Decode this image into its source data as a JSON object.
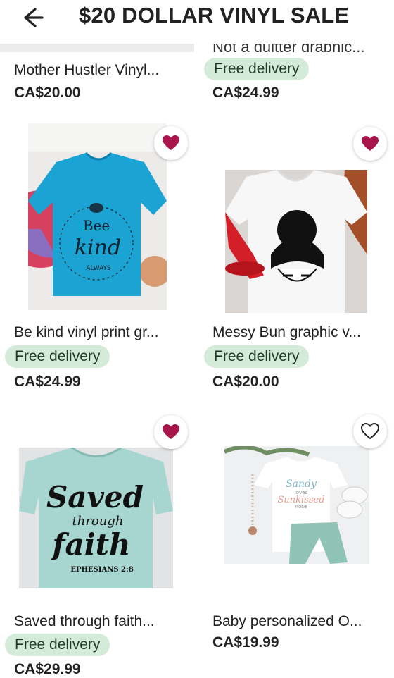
{
  "header": {
    "title": "$20 DOLLAR VINYL SALE",
    "back_icon": "arrow-left-icon"
  },
  "colors": {
    "accent_heart": "#a8154a",
    "badge_bg": "#d5ebd9"
  },
  "top_row": {
    "left": {
      "name": "Mother Hustler Vinyl...",
      "price": "CA$20.00"
    },
    "right": {
      "cut_name": "Not a quitter graphic...",
      "delivery": "Free delivery",
      "price": "CA$24.99"
    }
  },
  "products": [
    {
      "name": "Be kind vinyl print gr...",
      "delivery": "Free delivery",
      "price": "CA$24.99",
      "favorited": true,
      "art": {
        "line1": "Bee",
        "line2": "kind",
        "line3": "ALWAYS"
      }
    },
    {
      "name": "Messy Bun graphic v...",
      "delivery": "Free delivery",
      "price": "CA$20.00",
      "favorited": true
    },
    {
      "name": "Saved through faith...",
      "delivery": "Free delivery",
      "price": "CA$29.99",
      "favorited": true,
      "art": {
        "line1": "Saved",
        "line2": "through",
        "line3": "faith",
        "line4": "EPHESIANS 2:8"
      }
    },
    {
      "name": "Baby personalized O...",
      "price": "CA$19.99",
      "favorited": false,
      "art": {
        "line1": "Sandy",
        "line2": "loves",
        "line3": "Sunkissed",
        "line4": "nose"
      }
    }
  ]
}
